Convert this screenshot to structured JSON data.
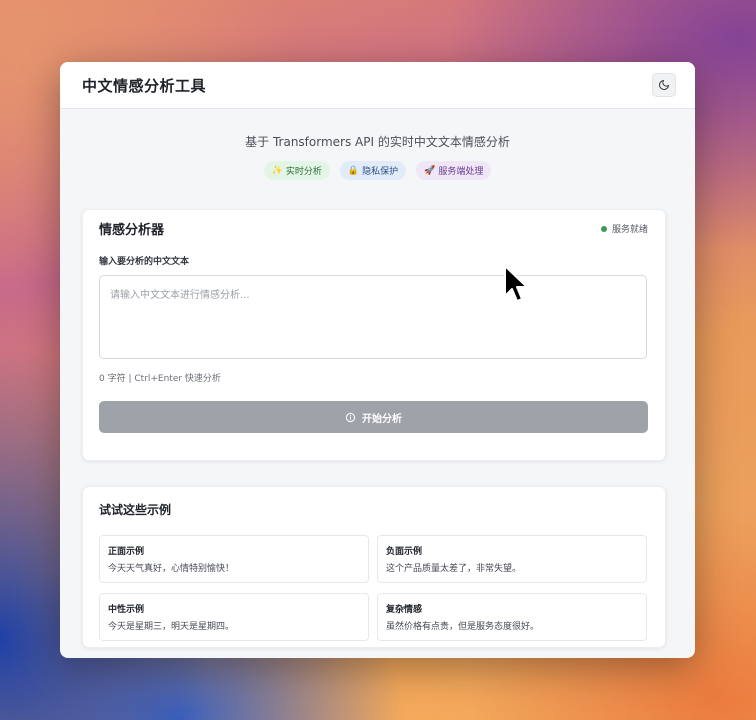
{
  "app": {
    "title": "中文情感分析工具",
    "subtitle": "基于 Transformers API 的实时中文文本情感分析"
  },
  "badges": [
    {
      "icon": "✨",
      "label": "实时分析"
    },
    {
      "icon": "🔒",
      "label": "隐私保护"
    },
    {
      "icon": "🚀",
      "label": "服务端处理"
    }
  ],
  "analyzer": {
    "title": "情感分析器",
    "status": "服务就绪",
    "status_color": "#3c9a55",
    "input_label": "输入要分析的中文文本",
    "input_placeholder": "请输入中文文本进行情感分析...",
    "input_value": "",
    "hint": "0 字符 | Ctrl+Enter 快速分析",
    "button_label": "开始分析",
    "button_color": "#9ea3aa"
  },
  "examples": {
    "title": "试试这些示例",
    "items": [
      {
        "title": "正面示例",
        "text": "今天天气真好，心情特别愉快！"
      },
      {
        "title": "负面示例",
        "text": "这个产品质量太差了，非常失望。"
      },
      {
        "title": "中性示例",
        "text": "今天是星期三，明天是星期四。"
      },
      {
        "title": "复杂情感",
        "text": "虽然价格有点贵，但是服务态度很好。"
      }
    ]
  }
}
